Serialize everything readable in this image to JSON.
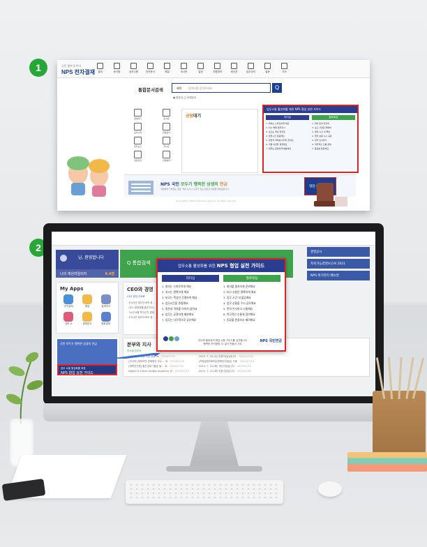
{
  "badges": [
    "1",
    "2"
  ],
  "shot1": {
    "logo_small": "국민 행복 도우미",
    "logo": "NPS 전자결재",
    "menu": [
      "결재",
      "문서함",
      "공지사항",
      "전자문서",
      "메일",
      "게시판",
      "일정",
      "자원예약",
      "메신저",
      "업무관리",
      "설문",
      "기타"
    ],
    "search_title": "통합문서검색",
    "search_scope": "제목",
    "search_placeholder": "검색어를 입력하세요.",
    "search_btn": "Q",
    "search_opts": "● 결과내 ◯ 전체검색",
    "apps": [
      "결재대기",
      "문서함",
      "공지사항",
      "회람문서",
      "업무보고",
      "게시판",
      "일정관리",
      "자원예약"
    ],
    "notice_title_a": "공람",
    "notice_title_b": "대기",
    "guide_head": "업무소통 활성화를 위한 NPS 협업 실천 가이드",
    "col_left": "리더십",
    "col_right": "팔로워십",
    "lines_left": [
      "1. 회의는 스마트하게 해요",
      "2. 지시 명확 업무지시",
      "3. 보고는 핵심 위주로",
      "4. 업무시간 존중해요",
      "5. 칭찬과 격려를 아끼지 않아요",
      "6. 직원 의견을 경청해요",
      "7. 업무는 공정하게 배분해요"
    ],
    "lines_right": [
      "1. 회의 준비 철저히",
      "2. 보고 사항은 명확히",
      "3. 업무 시간 내 몰입",
      "4. 업무 상황 수시 공유",
      "5. 먼저 인사하기",
      "6. 적극적인 소통 참여",
      "7. 동료를 존중해요"
    ],
    "banner_title_a": "NPS 국민",
    "banner_title_b": "모두가 행복한 상생의",
    "banner_title_c": "연금",
    "banner_sub": "국민에게 가치있는 연금, 국민 누구나 노후가 있는 든든한 연금을 만들겠습니다",
    "banner_btn": "협업 실천 가이드",
    "footer": "Copyright(c) National Pension Service. All rights reserved."
  },
  "shot2": {
    "profile_name": "님, 환영합니다",
    "profile_label": "나의 계산마일리지",
    "profile_value": "0.4점",
    "search_label": "Q 통합검색",
    "right_links": [
      "경영공시",
      "지속가능경영보고서 2021",
      "NPS 위기관리 매뉴얼"
    ],
    "myapps_title": "My Apps",
    "myapps": [
      "전자결재",
      "메일",
      "결재대기",
      "공문 소",
      "결재문서",
      "원화결재"
    ],
    "ceo_title": "CEO와 경영",
    "ceo_tabs": "CEO 방침 주요화",
    "ceo_lines": [
      "· 2024년 제2차 NPS 경...",
      "· CEO 경영현황(종주지도)",
      "· '24년 6월 투자신차 결재",
      "· 2024년 제2차 NPS 경..."
    ],
    "banner_a": "국민 모두가 행복한 상생의 연금",
    "banner_b_small": "업무 소통 활성화를 위한",
    "banner_b": "NPS 협업 실천 가이드",
    "lower_title": "본부와 지사",
    "lower_sub": "부서별 업무방",
    "lower_left": [
      {
        "t": "· [서대전] 주차장 사업 공유",
        "n": "N",
        "d": "2024/07/15"
      },
      {
        "t": "· [인사부] 정보보안 문화확산 우수...",
        "n": "N",
        "d": "2024/07/15"
      },
      {
        "t": "· [정책연구원] 월간경제 7월호 발...",
        "n": "N",
        "d": "2024/07/15"
      },
      {
        "t": "· Digital & Future Insight Academy",
        "n": "N",
        "d": "2024/07/15"
      }
    ],
    "lower_right": [
      {
        "t": "· 2024. 7. 24.(수) 인문가(씨)입니다",
        "d": "2024/07/15"
      },
      {
        "t": "· [보험설명처회의](정책인지점검) 가동",
        "d": "2024/07/15"
      },
      {
        "t": "· 2024. 7. 23.(화) 개인가입입니다",
        "d": "2024/07/15"
      },
      {
        "t": "· 2024. 7. 23.(화) 인문가입입니다",
        "d": "2024/07/15"
      }
    ]
  },
  "guide_big": {
    "head_small": "업무소통 활성화를 위한",
    "head": "NPS 협업 실천 가이드",
    "col_left": "리더십",
    "col_right": "팔로워십",
    "lines_left": [
      "1. 회의는 스마트하게 해요",
      "2. 지시는 명확하게 해요",
      "3. 보고는 핵심만 간결하게 해요",
      "4. 업무시간을 존중해요",
      "5. 칭찬과 격려를 아끼지 않아요",
      "6. 업무는 공정하게 배분해요",
      "7. 업무는 다각적으로 공유해요"
    ],
    "lines_right": [
      "1. 회의를 철저하게 준비해요",
      "2. 보고 사항은 명확하게 해요",
      "3. 업무 시간 내 몰입해요",
      "4. 업무 상황을 수시 공유해요",
      "5. 먼저 인사하고 소통해요",
      "6. 적극적인 소통에 참여해요",
      "7. 동료를 존중하고 배려해요"
    ],
    "foot": "리더와 팔로워의 협업 소통 가이드를 실천합니다",
    "foot2": "행복한 조직문화, 다 같이 만들어 가요",
    "logo": "NPS 국민연금"
  },
  "colors": {
    "green": "#3fa34d",
    "navy": "#2b3d8f",
    "red_border": "#dd2222",
    "highlight": "#ffe44a",
    "orange": "#e3852c"
  }
}
